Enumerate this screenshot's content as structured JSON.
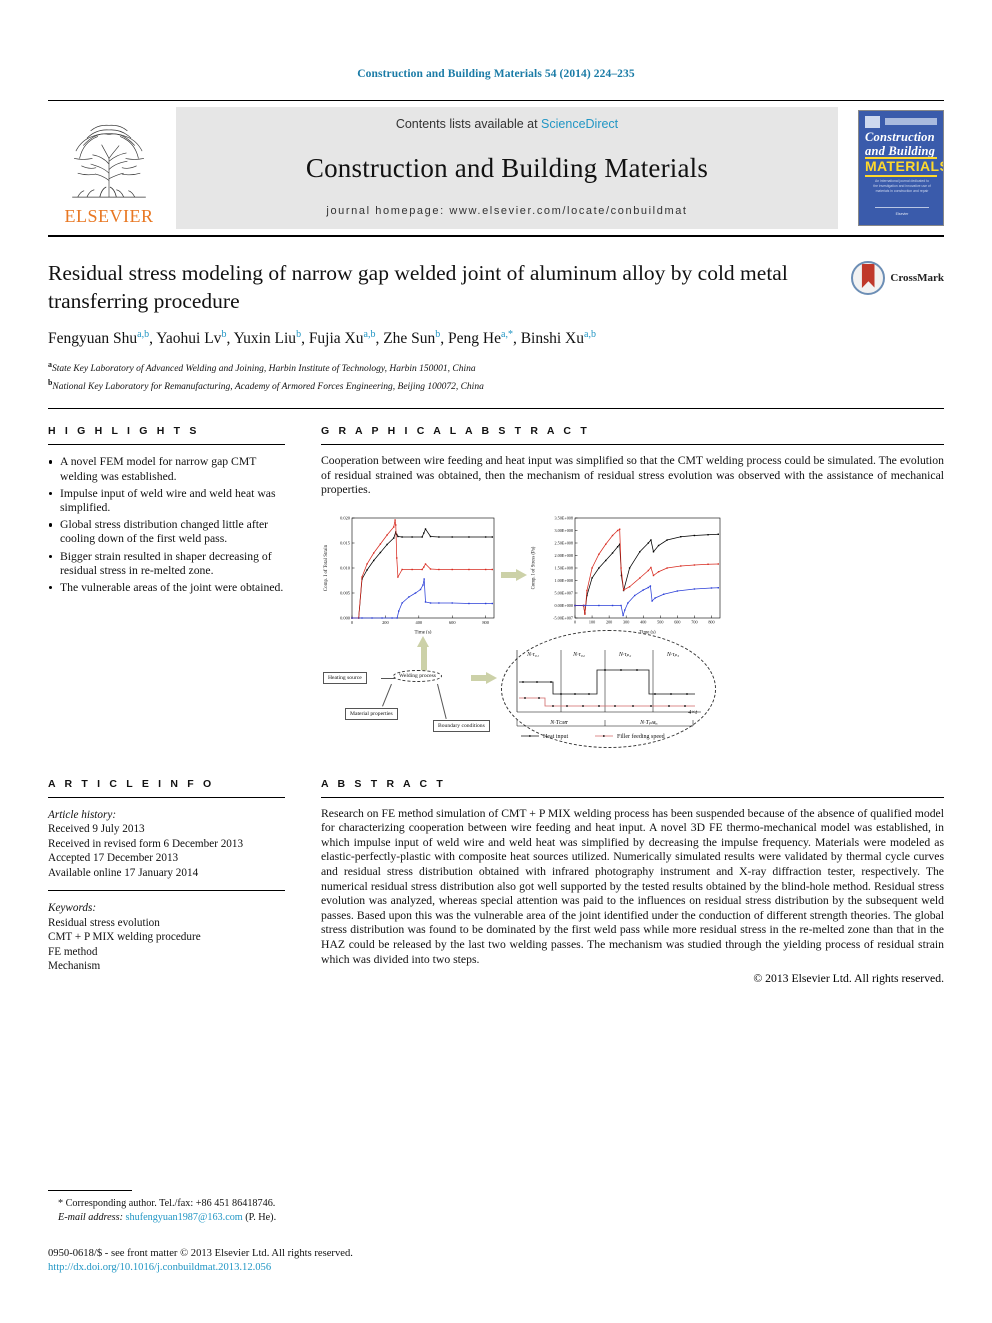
{
  "running_head": "Construction and Building Materials 54 (2014) 224–235",
  "masthead": {
    "publisher": "ELSEVIER",
    "contents_line_prefix": "Contents lists available at ",
    "contents_link": "ScienceDirect",
    "journal_title": "Construction and Building Materials",
    "homepage": "journal homepage: www.elsevier.com/locate/conbuildmat",
    "cover": {
      "line1": "Construction",
      "line2": "and Building",
      "line3": "MATERIALS",
      "blurb": "An international journal dedicated to the investigation and innovative use of materials in construction and repair",
      "foot": "Elsevier"
    }
  },
  "article": {
    "title": "Residual stress modeling of narrow gap welded joint of aluminum alloy by cold metal transferring procedure",
    "crossmark_label": "CrossMark",
    "authors": [
      {
        "name": "Fengyuan Shu",
        "sup": "a,b"
      },
      {
        "name": "Yaohui Lv",
        "sup": "b"
      },
      {
        "name": "Yuxin Liu",
        "sup": "b"
      },
      {
        "name": "Fujia Xu",
        "sup": "a,b"
      },
      {
        "name": "Zhe Sun",
        "sup": "b"
      },
      {
        "name": "Peng He",
        "sup": "a,*"
      },
      {
        "name": "Binshi Xu",
        "sup": "a,b"
      }
    ],
    "affiliations": [
      {
        "marker": "a",
        "text": "State Key Laboratory of Advanced Welding and Joining, Harbin Institute of Technology, Harbin 150001, China"
      },
      {
        "marker": "b",
        "text": "National Key Laboratory for Remanufacturing, Academy of Armored Forces Engineering, Beijing 100072, China"
      }
    ]
  },
  "highlights": {
    "heading": "H I G H L I G H T S",
    "items": [
      "A novel FEM model for narrow gap CMT welding was established.",
      "Impulse input of weld wire and weld heat was simplified.",
      "Global stress distribution changed little after cooling down of the first weld pass.",
      "Bigger strain resulted in shaper decreasing of residual stress in re-melted zone.",
      "The vulnerable areas of the joint were obtained."
    ]
  },
  "graphical_abstract": {
    "heading": "G R A P H I C A L   A B S T R A C T",
    "text": "Cooperation between wire feeding and heat input was simplified so that the CMT welding process could be simulated. The evolution of residual strained was obtained, then the mechanism of residual stress evolution was observed with the assistance of mechanical properties.",
    "flow": {
      "heating_source": "Heating source",
      "welding_process": "Welding process",
      "material_properties": "Material properties",
      "boundary_conditions": "Boundary conditions",
      "pulse_labels": [
        "N·τ₀₁",
        "N·τ₀₂",
        "N·τₚ₂",
        "N·τₚ₃"
      ],
      "pulse_bottom_labels": [
        "N·Tᴄᴍᴛ",
        "N·Tₚᴍᵢₓ"
      ],
      "axis_label": "4×t",
      "legend": [
        "Heat input",
        "Filler feeding speed"
      ]
    }
  },
  "chart_data": [
    {
      "type": "line",
      "title": "",
      "xlabel": "Time (s)",
      "ylabel": "Comp. I of Total Strain",
      "xlim": [
        0,
        850
      ],
      "ylim": [
        0.0,
        0.02
      ],
      "xticks": [
        0,
        200,
        400,
        600,
        800
      ],
      "yticks": [
        "0.000",
        "0.005",
        "0.010",
        "0.015",
        "0.020"
      ],
      "xtick_labels": [
        "0",
        "200",
        "400",
        "600",
        "800"
      ],
      "grid": false,
      "legend_position": "none",
      "series": [
        {
          "name": "pass 1 (black)",
          "color": "#000000",
          "x": [
            0,
            40,
            60,
            90,
            130,
            170,
            210,
            250,
            262,
            268,
            275,
            300,
            360,
            420,
            430,
            440,
            470,
            520,
            600,
            700,
            800,
            840
          ],
          "y": [
            0.0,
            0.0,
            0.0078,
            0.0096,
            0.0115,
            0.0131,
            0.0147,
            0.016,
            0.0172,
            0.0167,
            0.0163,
            0.0162,
            0.0162,
            0.0162,
            0.017,
            0.0178,
            0.0163,
            0.0162,
            0.0162,
            0.0162,
            0.0162,
            0.0162
          ]
        },
        {
          "name": "pass 2 (red)",
          "color": "#d82b20",
          "x": [
            0,
            40,
            60,
            90,
            130,
            170,
            210,
            250,
            258,
            262,
            268,
            275,
            300,
            360,
            420,
            430,
            440,
            470,
            520,
            600,
            700,
            800,
            840
          ],
          "y": [
            0.0,
            0.0,
            0.0082,
            0.0108,
            0.013,
            0.0148,
            0.0166,
            0.0182,
            0.0196,
            0.0186,
            0.012,
            0.0082,
            0.0097,
            0.0097,
            0.0097,
            0.0102,
            0.0108,
            0.0098,
            0.0097,
            0.0097,
            0.0097,
            0.0097,
            0.0097
          ]
        },
        {
          "name": "pass 3 (blue)",
          "color": "#2b3fd8",
          "x": [
            0,
            60,
            120,
            180,
            240,
            270,
            280,
            300,
            340,
            380,
            410,
            425,
            432,
            440,
            470,
            520,
            600,
            700,
            800,
            840
          ],
          "y": [
            0.0,
            0.0,
            0.0,
            0.0,
            0.0,
            0.0,
            0.0014,
            0.003,
            0.0042,
            0.005,
            0.0057,
            0.0066,
            0.0078,
            0.0032,
            0.003,
            0.003,
            0.003,
            0.0029,
            0.0029,
            0.0029
          ]
        }
      ]
    },
    {
      "type": "line",
      "title": "",
      "xlabel": "Time (s)",
      "ylabel": "Comp. I of Stress (Pa)",
      "xlim": [
        0,
        850
      ],
      "ylim": [
        -50000000,
        350000000
      ],
      "xticks": [
        0,
        100,
        200,
        300,
        400,
        500,
        600,
        700,
        800
      ],
      "xtick_labels": [
        "0",
        "100",
        "200",
        "300",
        "400",
        "500",
        "600",
        "700",
        "800"
      ],
      "yticks": [
        "-5.00E+007",
        "0.00E+000",
        "5.00E+007",
        "1.00E+008",
        "1.50E+008",
        "2.00E+008",
        "2.50E+008",
        "3.00E+008",
        "3.50E+008"
      ],
      "grid": false,
      "legend_position": "none",
      "series": [
        {
          "name": "pass 1 (black)",
          "color": "#000000",
          "x": [
            0,
            50,
            58,
            70,
            100,
            140,
            180,
            220,
            250,
            262,
            272,
            285,
            320,
            380,
            430,
            445,
            460,
            490,
            540,
            620,
            700,
            780,
            840
          ],
          "y": [
            0,
            0,
            -30000000,
            40000000,
            110000000,
            150000000,
            180000000,
            210000000,
            235000000,
            245000000,
            120000000,
            60000000,
            150000000,
            215000000,
            250000000,
            262000000,
            215000000,
            240000000,
            262000000,
            275000000,
            280000000,
            283000000,
            285000000
          ]
        },
        {
          "name": "pass 2 (red)",
          "color": "#d82b20",
          "x": [
            0,
            50,
            58,
            70,
            100,
            140,
            180,
            220,
            250,
            262,
            270,
            285,
            320,
            380,
            430,
            445,
            460,
            490,
            540,
            620,
            700,
            780,
            840
          ],
          "y": [
            0,
            0,
            -35000000,
            60000000,
            150000000,
            205000000,
            245000000,
            280000000,
            300000000,
            305000000,
            150000000,
            62000000,
            75000000,
            110000000,
            140000000,
            152000000,
            120000000,
            135000000,
            150000000,
            158000000,
            162000000,
            165000000,
            166000000
          ]
        },
        {
          "name": "pass 3 (blue)",
          "color": "#2b3fd8",
          "x": [
            0,
            60,
            140,
            220,
            270,
            282,
            292,
            310,
            350,
            400,
            430,
            442,
            452,
            470,
            520,
            600,
            700,
            800,
            840
          ],
          "y": [
            0,
            0,
            0,
            0,
            0,
            -40000000,
            -18000000,
            10000000,
            40000000,
            62000000,
            72000000,
            78000000,
            18000000,
            30000000,
            45000000,
            58000000,
            66000000,
            70000000,
            71000000
          ]
        }
      ]
    }
  ],
  "article_info": {
    "heading": "A R T I C L E   I N F O",
    "history_label": "Article history:",
    "history": [
      "Received 9 July 2013",
      "Received in revised form 6 December 2013",
      "Accepted 17 December 2013",
      "Available online 17 January 2014"
    ],
    "keywords_label": "Keywords:",
    "keywords": [
      "Residual stress evolution",
      "CMT + P MIX welding procedure",
      "FE method",
      "Mechanism"
    ]
  },
  "abstract": {
    "heading": "A B S T R A C T",
    "text": "Research on FE method simulation of CMT + P MIX welding process has been suspended because of the absence of qualified model for characterizing cooperation between wire feeding and heat input. A novel 3D FE thermo-mechanical model was established, in which impulse input of weld wire and weld heat was simplified by decreasing the impulse frequency. Materials were modeled as elastic-perfectly-plastic with composite heat sources utilized. Numerically simulated results were validated by thermal cycle curves and residual stress distribution obtained with infrared photography instrument and X-ray diffraction tester, respectively. The numerical residual stress distribution also got well supported by the tested results obtained by the blind-hole method. Residual stress evolution was analyzed, whereas special attention was paid to the influences on residual stress distribution by the subsequent weld passes. Based upon this was the vulnerable area of the joint identified under the conduction of different strength theories. The global stress distribution was found to be dominated by the first weld pass while more residual stress in the re-melted zone than that in the HAZ could be released by the last two welding passes. The mechanism was studied through the yielding process of residual strain which was divided into two steps.",
    "copyright": "© 2013 Elsevier Ltd. All rights reserved."
  },
  "footer": {
    "corresponding": "* Corresponding author. Tel./fax: +86 451 86418746.",
    "email_label": "E-mail address:",
    "email": "shufengyuan1987@163.com",
    "email_suffix": "(P. He).",
    "issn_line": "0950-0618/$ - see front matter © 2013 Elsevier Ltd. All rights reserved.",
    "doi": "http://dx.doi.org/10.1016/j.conbuildmat.2013.12.056"
  },
  "colors": {
    "link": "#2196c4",
    "elsevier_orange": "#E87722",
    "cover_blue": "#3a5bab",
    "cover_yellow": "#ffd92b",
    "series_black": "#000000",
    "series_red": "#d82b20",
    "series_blue": "#2b3fd8",
    "arrow_olive": "#ccd1a8"
  }
}
